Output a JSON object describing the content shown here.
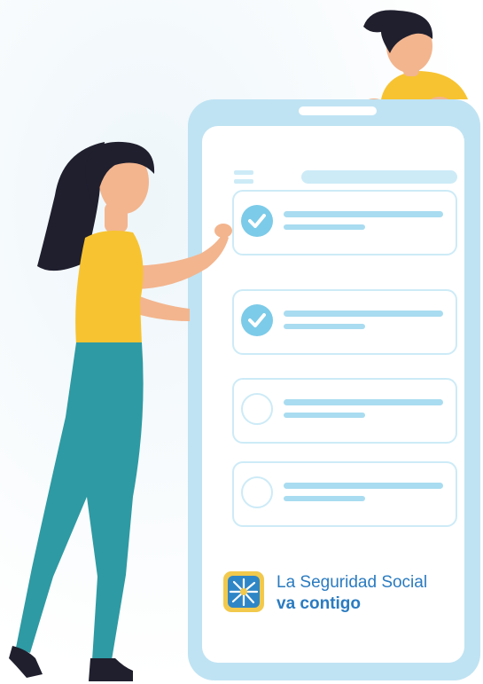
{
  "brand": {
    "line1": "La Seguridad Social",
    "line2": "va contigo",
    "logo_icon": "social-security-star-icon",
    "colors": {
      "text": "#2a7bc0",
      "logo_frame": "#f2c94c",
      "logo_fill": "#2f86c7"
    }
  },
  "phone_screen": {
    "menu_icon": "hamburger-menu-icon",
    "tasks": [
      {
        "status": "checked"
      },
      {
        "status": "checked"
      },
      {
        "status": "unchecked"
      },
      {
        "status": "unchecked"
      }
    ]
  },
  "illustration": {
    "people": [
      "woman-standing",
      "man-peeking"
    ],
    "colors": {
      "shirt": "#f7c331",
      "pants": "#2e9aa3",
      "hair": "#1f1f2e",
      "skin": "#f3b58e",
      "phone": "#bfe3f3"
    }
  }
}
